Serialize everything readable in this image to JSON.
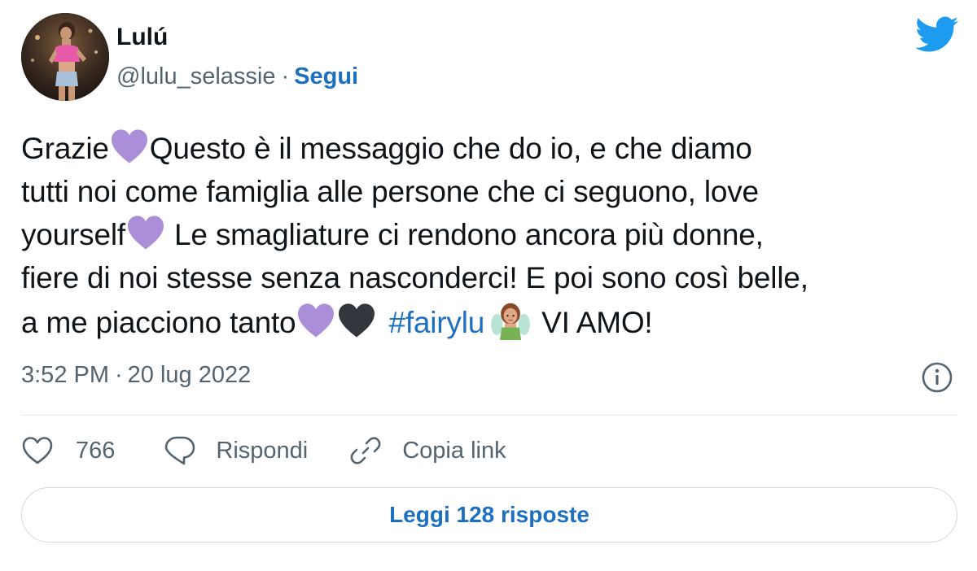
{
  "author": {
    "display_name": "Lulú",
    "handle": "@lulu_selassie",
    "separator": "·",
    "follow_label": "Segui"
  },
  "tweet": {
    "line1_a": "Grazie",
    "line1_b": "Questo è il messaggio che do io, e che diamo",
    "line2": "tutti noi come famiglia alle persone che ci seguono, love",
    "line3_a": "yourself",
    "line3_b": " Le smagliature ci rendono ancora più donne,",
    "line4": "fiere di noi stesse senza nasconderci! E poi sono così belle,",
    "line5_a": "a me piacciono tanto",
    "hashtag": "#fairylu",
    "line5_end": "VI AMO!",
    "emoji": [
      "purple-heart",
      "purple-heart",
      "purple-heart",
      "black-heart",
      "fairy"
    ]
  },
  "meta": {
    "time": "3:52 PM",
    "separator": "·",
    "date": "20 lug 2022"
  },
  "actions": {
    "like_count": "766",
    "reply_label": "Rispondi",
    "copy_label": "Copia link"
  },
  "replies_button": {
    "label": "Leggi 128 risposte"
  },
  "colors": {
    "brand_blue": "#1d9bf0",
    "link_blue": "#1d6fbf",
    "text": "#0f1419",
    "secondary_text": "#536471",
    "purple_heart": "#ab8ed8",
    "black_heart": "#31373d",
    "border": "#cfd9de"
  },
  "icons": [
    "twitter-bird-icon",
    "info-icon",
    "heart-icon",
    "reply-bubble-icon",
    "link-icon"
  ]
}
